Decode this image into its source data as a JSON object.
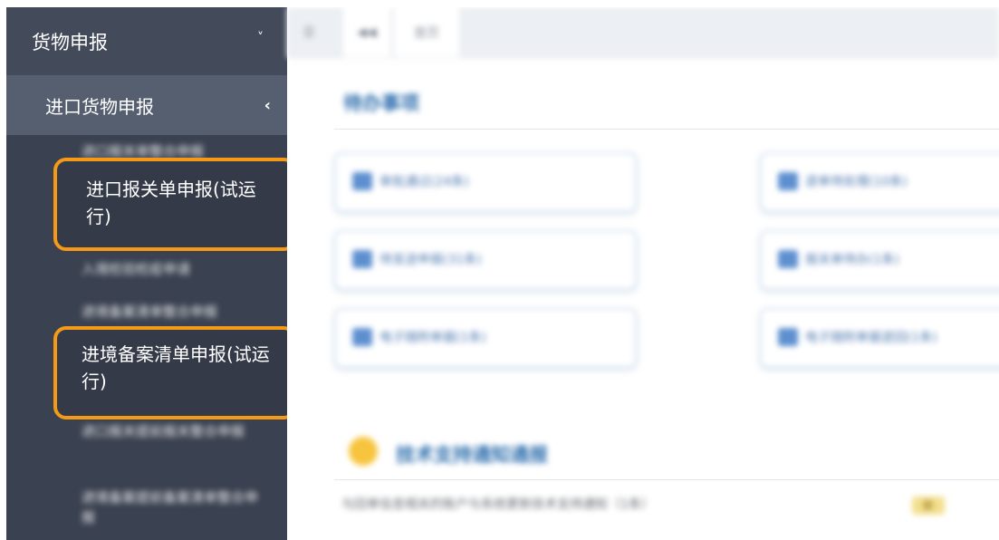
{
  "sidebar": {
    "menu_title": "货物申报",
    "menu_chevron": "˅",
    "submenu_title": "进口货物申报",
    "submenu_chevron": "‹",
    "items": [
      "进口报关单整合申报",
      "进口报关单申报(试运行)",
      "入境检验检疫申请",
      "进境备案清单整合申报",
      "进境备案清单申报(试运行)",
      "进口报关提前报关整合申报",
      "进境备案提前备案清单整合申报"
    ]
  },
  "tabs": {
    "t1": "☰",
    "t2": "◀◀",
    "t3": "首页"
  },
  "main": {
    "section_title": "待办事项",
    "cards": [
      "审批通过(24条)",
      "退单待处理(10条)",
      "待发送申报(31条)",
      "报关单待办(1条)",
      "电子随附单据(1条)",
      "电子随附单据退回(1条)"
    ],
    "notice_title": "技术支持通知通报",
    "notice_item": "与回单信息相关的账户与系统更新技术支持通知（1条）",
    "notice_badge": "新"
  },
  "colors": {
    "sidebar_bg": "#3a4150",
    "highlight_border": "#f59a17",
    "accent_blue": "#2f6fae"
  }
}
